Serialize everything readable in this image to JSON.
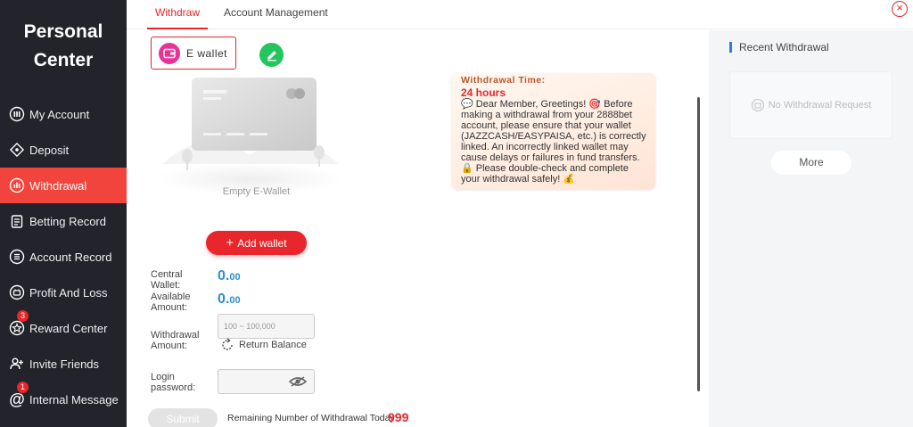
{
  "sidebar": {
    "brand_line1": "Personal",
    "brand_line2": "Center",
    "items": [
      {
        "label": "My Account",
        "icon": "account-icon"
      },
      {
        "label": "Deposit",
        "icon": "deposit-icon"
      },
      {
        "label": "Withdrawal",
        "icon": "withdrawal-icon",
        "active": true
      },
      {
        "label": "Betting Record",
        "icon": "betting-record-icon"
      },
      {
        "label": "Account Record",
        "icon": "account-record-icon"
      },
      {
        "label": "Profit And Loss",
        "icon": "profit-loss-icon"
      },
      {
        "label": "Reward Center",
        "icon": "reward-icon",
        "badge": "3"
      },
      {
        "label": "Invite Friends",
        "icon": "invite-icon"
      },
      {
        "label": "Internal Message",
        "icon": "message-icon",
        "badge": "1"
      }
    ]
  },
  "tabs": {
    "withdraw": "Withdraw",
    "account_management": "Account Management"
  },
  "wallet": {
    "tab_label": "E wallet",
    "empty_label": "Empty E-Wallet",
    "add_wallet_label": "Add wallet"
  },
  "notice": {
    "title": "Withdrawal Time:",
    "hours": "24 hours",
    "body1": "Dear Member, Greetings!",
    "body2": "Before making a withdrawal from your 2888bet account, please ensure that your wallet (JAZZCASH/EASYPAISA, etc.) is correctly linked. An incorrectly linked wallet may cause delays or failures in fund transfers.",
    "body3": "Please double-check and complete your withdrawal safely!"
  },
  "form": {
    "central_wallet_label_1": "Central",
    "central_wallet_label_2": "Wallet:",
    "central_wallet_int": "0.",
    "central_wallet_dec": "00",
    "available_label_1": "Available",
    "available_label_2": "Amount:",
    "available_int": "0.",
    "available_dec": "00",
    "withdrawal_amount_label_1": "Withdrawal",
    "withdrawal_amount_label_2": "Amount:",
    "withdrawal_amount_placeholder": "100 ~ 100,000",
    "return_balance_label": "Return Balance",
    "login_password_label_1": "Login",
    "login_password_label_2": "password:",
    "submit_label": "Submit",
    "remaining_label": "Remaining Number of Withdrawal Today:",
    "remaining_count": "999"
  },
  "right_panel": {
    "title": "Recent Withdrawal",
    "empty_text": "No Withdrawal Request",
    "more_label": "More"
  },
  "colors": {
    "accent": "#e8262b",
    "sidebar_bg": "#22232b",
    "amount_blue": "#2d8fd0"
  }
}
